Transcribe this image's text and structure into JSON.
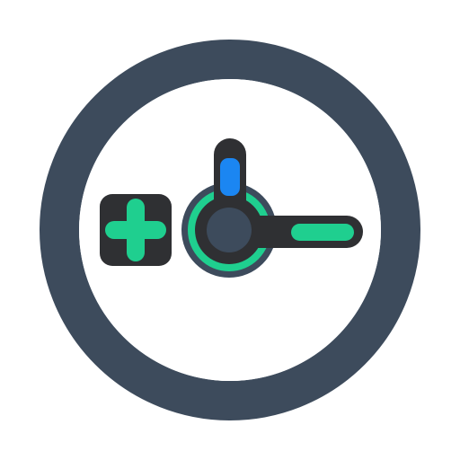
{
  "icon": {
    "name": "clock-add-icon",
    "colors": {
      "background": "#ffffff",
      "ring": "#3d4b5c",
      "face": "#ffffff",
      "dark": "#2f3033",
      "accent_green": "#1fcf8f",
      "accent_blue": "#1b86f2",
      "hub": "#3d4b5c"
    }
  }
}
